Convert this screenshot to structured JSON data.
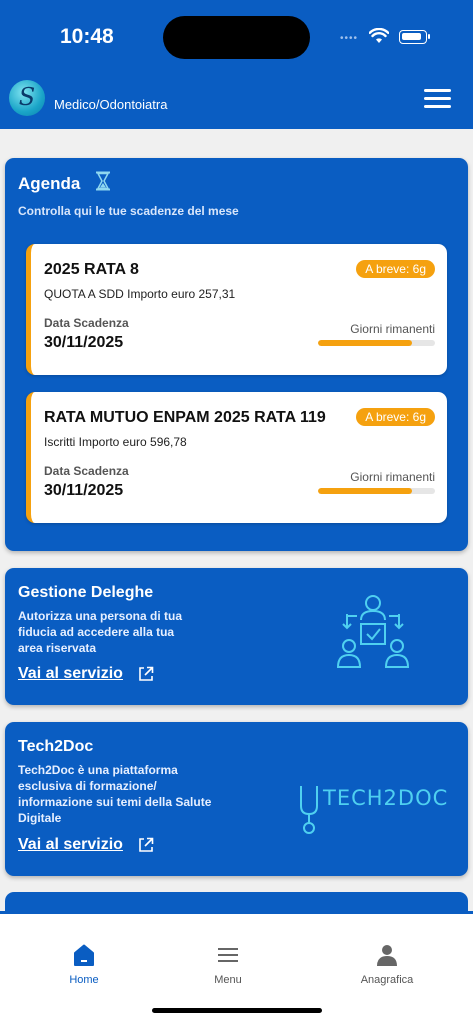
{
  "status_bar": {
    "time": "10:48"
  },
  "header": {
    "role": "Medico/Odontoiatra"
  },
  "agenda": {
    "title": "Agenda",
    "subtitle": "Controlla qui le tue scadenze del mese",
    "items": [
      {
        "title": "2025 RATA 8",
        "badge": "A breve: 6g",
        "description": "QUOTA A SDD  Importo euro 257,31",
        "date_label": "Data Scadenza",
        "date": "30/11/2025",
        "remaining_label": "Giorni rimanenti",
        "progress": 0.8
      },
      {
        "title": "RATA MUTUO ENPAM 2025 RATA 119",
        "badge": "A breve: 6g",
        "description": "Iscritti Importo euro 596,78",
        "date_label": "Data Scadenza",
        "date": "30/11/2025",
        "remaining_label": "Giorni rimanenti",
        "progress": 0.8
      }
    ]
  },
  "deleghe": {
    "title": "Gestione Deleghe",
    "lines": [
      "Autorizza una persona di tua",
      "fiducia ad accedere alla tua",
      "area riservata"
    ],
    "link": "Vai al servizio"
  },
  "tech2doc": {
    "title": "Tech2Doc",
    "lines": [
      "Tech2Doc è una piattaforma",
      "esclusiva di formazione/",
      "informazione sui temi della Salute",
      "Digitale"
    ],
    "link": "Vai al servizio",
    "logo_text": "TECH2DOC"
  },
  "tabbar": {
    "home": "Home",
    "menu": "Menu",
    "anagrafica": "Anagrafica"
  },
  "colors": {
    "primary": "#0a5dc2",
    "accent": "#f5a10f"
  }
}
